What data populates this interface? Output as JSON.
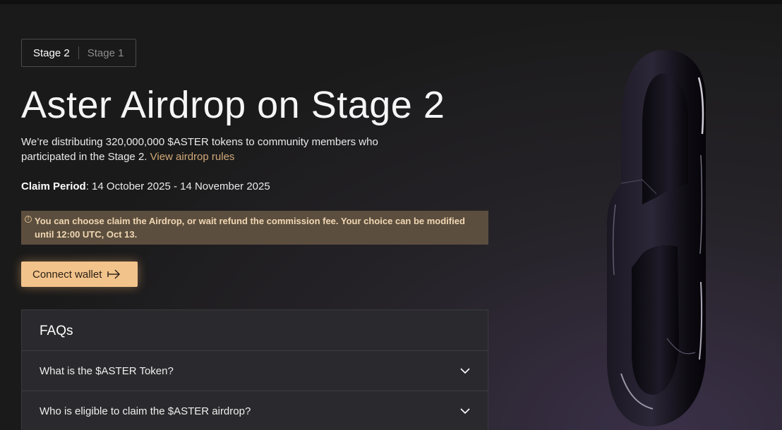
{
  "stage_tabs": [
    {
      "label": "Stage 2",
      "active": true
    },
    {
      "label": "Stage 1",
      "active": false
    }
  ],
  "page_title": "Aster Airdrop on Stage 2",
  "description": {
    "text": "We’re distributing 320,000,000 $ASTER tokens to community members who participated in the Stage 2.",
    "link_text": "View airdrop rules"
  },
  "claim_period": {
    "label": "Claim Period",
    "value": "14 October 2025 - 14 November 2025"
  },
  "notice": {
    "icon": "info-icon",
    "text": "You can choose claim the Airdrop, or wait refund the commission fee. Your choice can be modified until 12:00 UTC, Oct 13."
  },
  "connect_wallet": {
    "label": "Connect wallet",
    "icon": "arrow-right-icon"
  },
  "faq": {
    "title": "FAQs",
    "items": [
      {
        "question": "What is the $ASTER Token?",
        "icon": "chevron-down-icon"
      },
      {
        "question": "Who is eligible to claim the $ASTER airdrop?",
        "icon": "chevron-down-icon"
      }
    ]
  },
  "colors": {
    "accent": "#f2c38b",
    "link": "#d2a977",
    "notice_bg": "#5c4e3e",
    "notice_text": "#f0d7b3",
    "faq_bg": "#2a2a2e"
  }
}
